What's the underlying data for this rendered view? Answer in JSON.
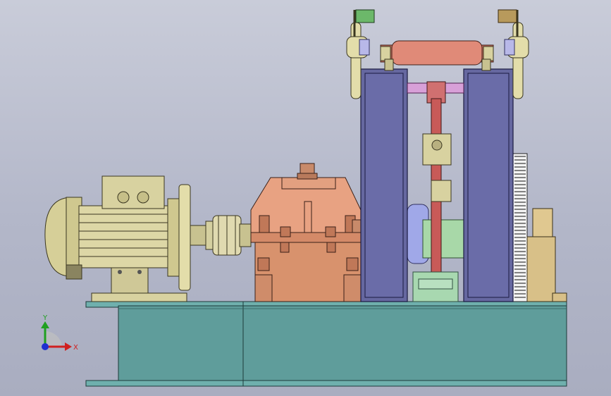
{
  "viewport": {
    "background_top": "#c9ccd9",
    "background_bottom": "#a9adc0"
  },
  "model": {
    "components": [
      "base-frame",
      "electric-motor",
      "flexible-coupling",
      "gearbox",
      "roll-frame-left",
      "roll-frame-right",
      "top-roller",
      "connecting-rod",
      "drive-shaft",
      "gear-rack",
      "bearing-pedestal",
      "lever-arm-left",
      "lever-arm-right",
      "flag-left",
      "flag-right"
    ],
    "colors": {
      "base": "#5f9d9b",
      "motor": "#d8d2a0",
      "gearbox": "#d8926d",
      "frame": "#6668a0",
      "roller": "#e08a78",
      "rod": "#c85a58",
      "shaft": "#a8d8a8",
      "flag_left": "#6cb86a",
      "flag_right": "#b89a5c"
    }
  },
  "triad": {
    "x_label": "X",
    "y_label": "Y",
    "x_color": "#d02020",
    "y_color": "#20a020"
  }
}
